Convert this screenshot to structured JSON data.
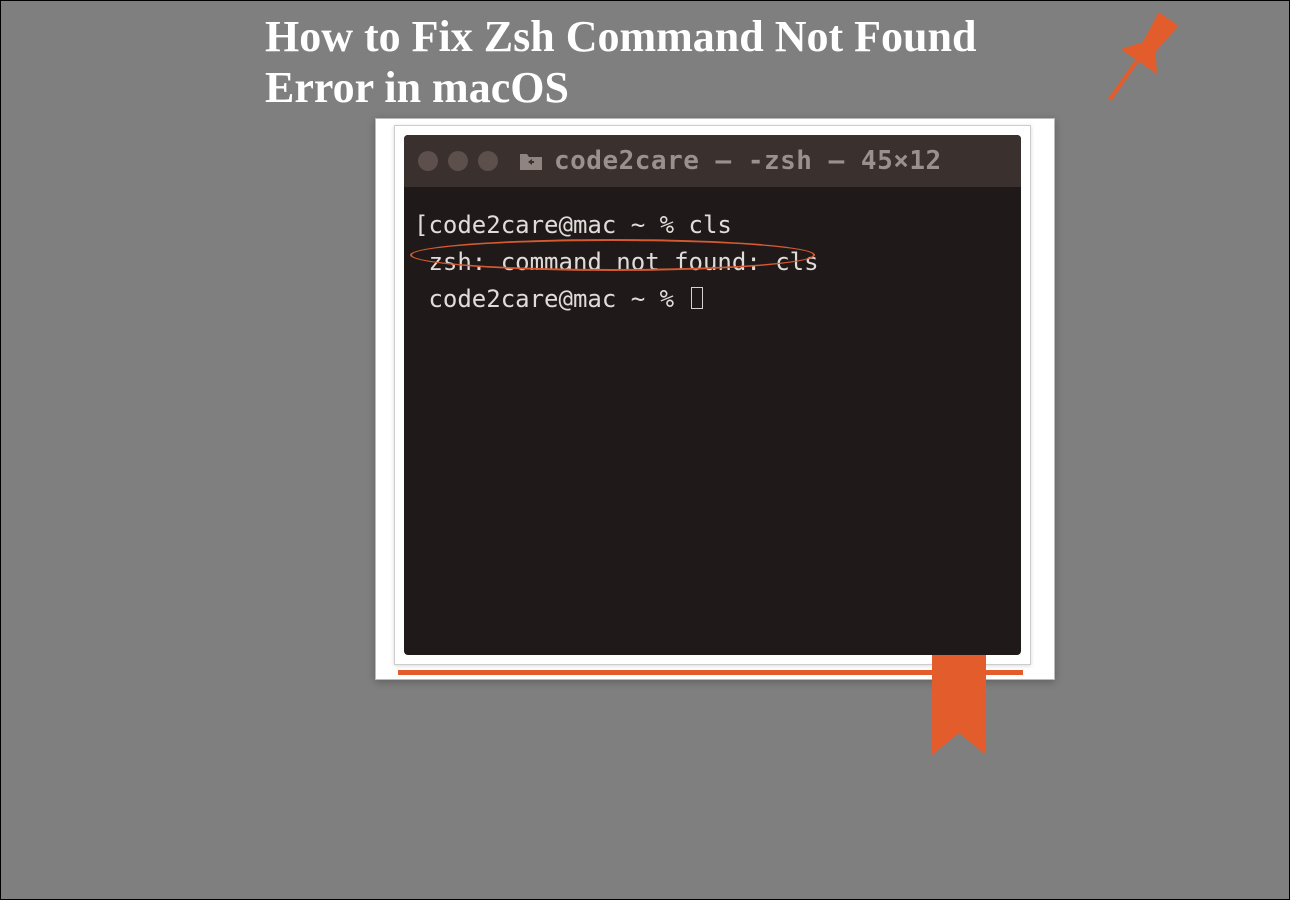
{
  "title": "How to Fix Zsh Command Not Found Error in macOS",
  "terminal": {
    "window_title": "code2care — -zsh — 45×12",
    "lines": {
      "line1": "[code2care@mac ~ % cls",
      "line2": " zsh: command not found: cls",
      "line3_prompt": " code2care@mac ~ % "
    }
  },
  "colors": {
    "accent_orange": "#e25c2c",
    "accent_green": "#7e9a3a"
  },
  "icons": {
    "pin": "pin-icon",
    "bookmark": "bookmark-icon",
    "folder": "folder-icon"
  }
}
